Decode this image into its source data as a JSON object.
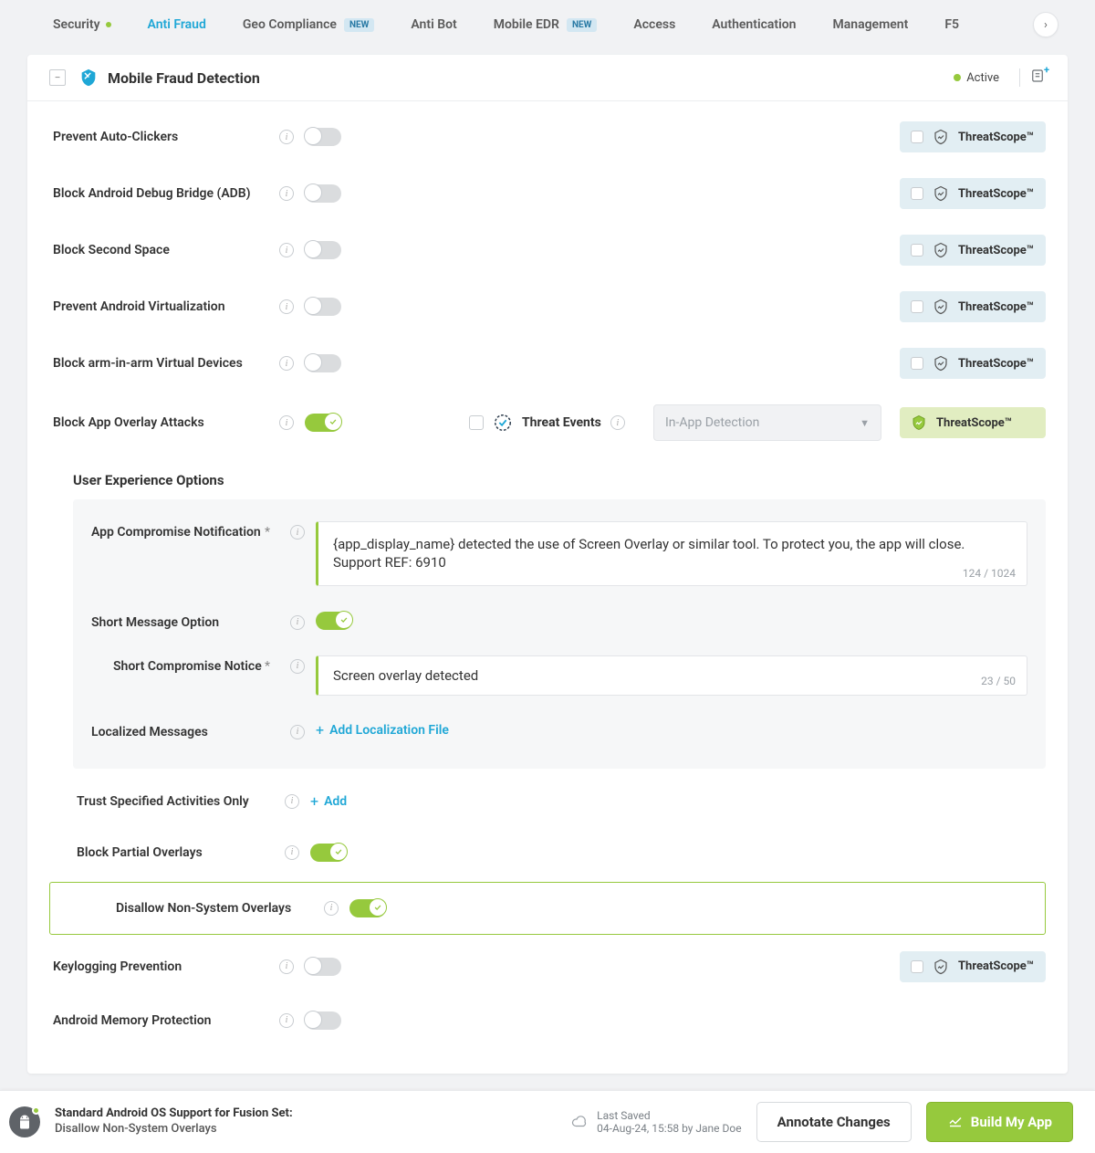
{
  "nav": {
    "items": [
      {
        "label": "Security",
        "dot": true
      },
      {
        "label": "Anti Fraud",
        "active": true
      },
      {
        "label": "Geo Compliance",
        "badge": "NEW"
      },
      {
        "label": "Anti Bot"
      },
      {
        "label": "Mobile EDR",
        "badge": "NEW"
      },
      {
        "label": "Access"
      },
      {
        "label": "Authentication"
      },
      {
        "label": "Management"
      },
      {
        "label": "F5"
      }
    ]
  },
  "panel": {
    "title": "Mobile Fraud Detection",
    "status_label": "Active"
  },
  "rows": {
    "prevent_auto_clickers": "Prevent Auto-Clickers",
    "block_adb": "Block Android Debug Bridge (ADB)",
    "block_second_space": "Block Second Space",
    "prevent_virtualization": "Prevent Android Virtualization",
    "block_arm_in_arm": "Block arm-in-arm Virtual Devices",
    "block_overlay": "Block App Overlay Attacks",
    "trust_activities": "Trust Specified Activities Only",
    "block_partial": "Block Partial Overlays",
    "disallow_nonsys": "Disallow Non-System Overlays",
    "keylogging": "Keylogging Prevention",
    "memory_protection": "Android Memory Protection"
  },
  "threat_events": {
    "label": "Threat Events",
    "select_placeholder": "In-App Detection"
  },
  "threatscope_label": "ThreatScope™",
  "uxo": {
    "title": "User Experience Options",
    "app_compromise_label": "App Compromise Notification",
    "app_compromise_text": "{app_display_name} detected the use of Screen Overlay or similar tool. To protect you, the app will close. Support REF: 6910",
    "app_compromise_counter": "124 / 1024",
    "short_msg_label": "Short Message Option",
    "short_notice_label": "Short Compromise Notice",
    "short_notice_text": "Screen overlay detected",
    "short_notice_counter": "23 / 50",
    "localized_label": "Localized Messages",
    "add_localization": "Add Localization File",
    "add_label": "Add"
  },
  "footer": {
    "line1": "Standard Android OS Support for Fusion Set:",
    "line2": "Disallow Non-System Overlays",
    "saved_label": "Last Saved",
    "saved_time": "04-Aug-24, 15:58 by Jane Doe",
    "annotate_btn": "Annotate Changes",
    "build_btn": "Build My App"
  }
}
